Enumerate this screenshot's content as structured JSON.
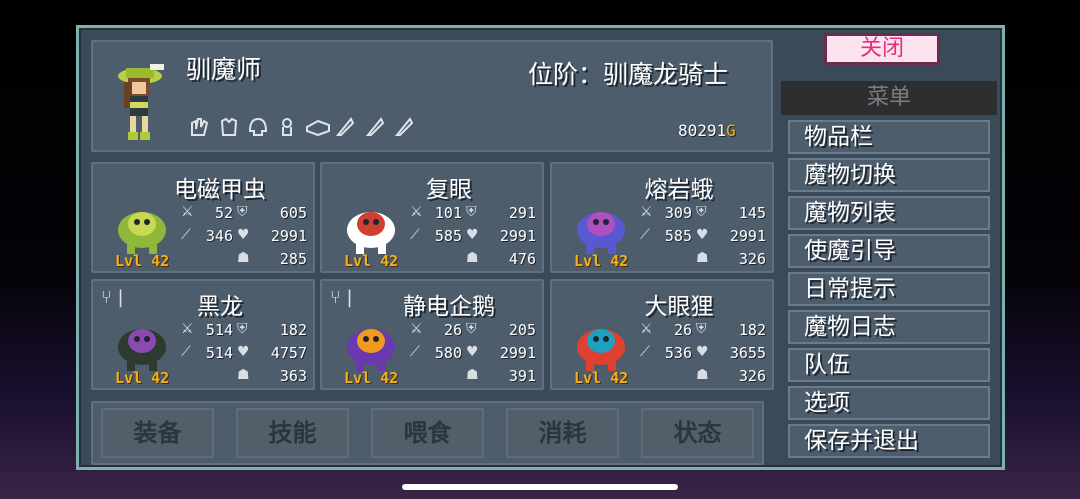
{
  "header": {
    "class_name": "驯魔师",
    "rank_label": "位阶：驯魔龙骑士",
    "gold_amount": "80291",
    "gold_symbol": "G",
    "equipment_icons": [
      "glove-icon",
      "armor-icon",
      "helmet-icon",
      "ring-icon",
      "tome-icon",
      "feather-icon",
      "feather-icon",
      "feather-icon"
    ]
  },
  "monsters": [
    {
      "name": "电磁甲虫",
      "atk": "52",
      "def": "605",
      "matk": "346",
      "hp": "2991",
      "food": "285",
      "level": "Lvl 42",
      "utensil": false
    },
    {
      "name": "复眼",
      "atk": "101",
      "def": "291",
      "matk": "585",
      "hp": "2991",
      "food": "476",
      "level": "Lvl 42",
      "utensil": false
    },
    {
      "name": "熔岩蛾",
      "atk": "309",
      "def": "145",
      "matk": "585",
      "hp": "2991",
      "food": "326",
      "level": "Lvl 42",
      "utensil": false
    },
    {
      "name": "黑龙",
      "atk": "514",
      "def": "182",
      "matk": "514",
      "hp": "4757",
      "food": "363",
      "level": "Lvl 42",
      "utensil": true
    },
    {
      "name": "静电企鹅",
      "atk": "26",
      "def": "205",
      "matk": "580",
      "hp": "2991",
      "food": "391",
      "level": "Lvl 42",
      "utensil": true
    },
    {
      "name": "大眼狸",
      "atk": "26",
      "def": "182",
      "matk": "536",
      "hp": "3655",
      "food": "326",
      "level": "Lvl 42",
      "utensil": false
    }
  ],
  "tabs": [
    "装备",
    "技能",
    "喂食",
    "消耗",
    "状态"
  ],
  "sidebar": {
    "close_label": "关闭",
    "menu_title": "菜单",
    "items": [
      "物品栏",
      "魔物切换",
      "魔物列表",
      "使魔引导",
      "日常提示",
      "魔物日志",
      "队伍",
      "选项",
      "保存并退出"
    ]
  },
  "colors": {
    "frame": "#3b4a58",
    "panel": "#4d5d6c",
    "level": "#f2b01e",
    "close_bg": "#fde3ef",
    "close_text": "#e0307a"
  }
}
